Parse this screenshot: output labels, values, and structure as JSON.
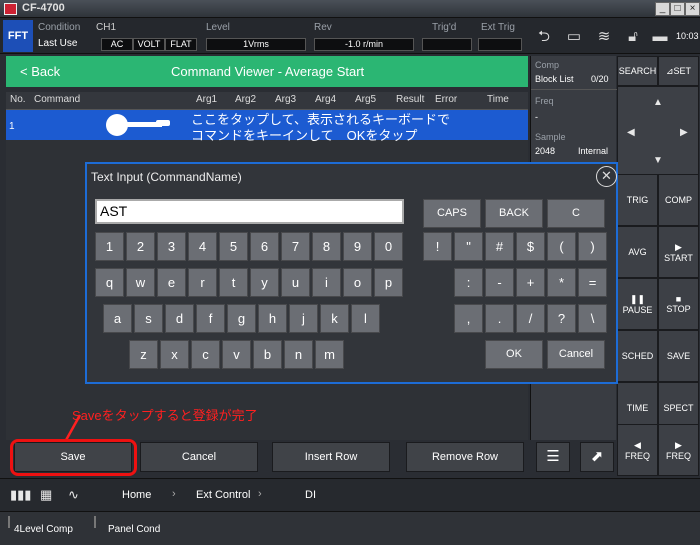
{
  "window": {
    "title": "CF-4700"
  },
  "status": {
    "mode": "FFT",
    "condition_label": "Condition",
    "condition_value": "Last Use",
    "channel_label": "CH1",
    "ch_settings": [
      "AC",
      "VOLT",
      "FLAT"
    ],
    "level_label": "Level",
    "level_value": "1Vrms",
    "rev_label": "Rev",
    "rev_value": "-1.0 r/min",
    "trig_label": "Trig'd",
    "exttrig_label": "Ext Trig",
    "clock": "10:03"
  },
  "header": {
    "back_label": "< Back",
    "title": "Command Viewer -  Average Start"
  },
  "table": {
    "columns": [
      "No.",
      "Command",
      "Arg1",
      "Arg2",
      "Arg3",
      "Arg4",
      "Arg5",
      "Result",
      "Error",
      "Time"
    ],
    "row1_no": "1",
    "row1_hint_line1": "ここをタップして、表示されるキーボードで",
    "row1_hint_line2": "コマンドをキーインして　OKをタップ"
  },
  "info_panel": {
    "comp_label": "Comp",
    "block_list_label": "Block List",
    "block_list_value": "0/20",
    "freq_label": "Freq",
    "freq_value": "-",
    "sample_label": "Sample",
    "sample_value": "2048",
    "sample_mode": "Internal"
  },
  "right_keys": {
    "search": "SEARCH",
    "set": "⊿SET",
    "trig": "TRIG",
    "comp": "COMP",
    "avg": "AVG",
    "start": "START",
    "pause": "PAUSE",
    "stop": "STOP",
    "sched": "SCHED",
    "save": "SAVE",
    "time": "TIME",
    "spect": "SPECT",
    "freq_left": "FREQ",
    "freq_right": "FREQ"
  },
  "dialog": {
    "title": "Text Input (CommandName)",
    "input_value": "AST",
    "row1": [
      "1",
      "2",
      "3",
      "4",
      "5",
      "6",
      "7",
      "8",
      "9",
      "0"
    ],
    "row2": [
      "q",
      "w",
      "e",
      "r",
      "t",
      "y",
      "u",
      "i",
      "o",
      "p"
    ],
    "row3": [
      "a",
      "s",
      "d",
      "f",
      "g",
      "h",
      "j",
      "k",
      "l"
    ],
    "row4": [
      "z",
      "x",
      "c",
      "v",
      "b",
      "n",
      "m"
    ],
    "caps": "CAPS",
    "backspace": "BACK",
    "clear": "C",
    "sym1": [
      "!",
      "\"",
      "#",
      "$",
      "(",
      ")"
    ],
    "sym2": [
      ":",
      "-",
      "+",
      "*",
      "="
    ],
    "sym3": [
      ",",
      ".",
      "/",
      "?",
      "\\"
    ],
    "ok": "OK",
    "cancel": "Cancel"
  },
  "annotation": {
    "text": "Saveをタップすると登録が完了",
    "color": "#ff2020"
  },
  "bottom_buttons": {
    "save": "Save",
    "cancel": "Cancel",
    "insert_row": "Insert Row",
    "remove_row": "Remove Row"
  },
  "breadcrumb": [
    "Home",
    "Ext Control",
    "DI"
  ],
  "footer_tabs": [
    "4Level Comp",
    "Panel Cond"
  ],
  "colors": {
    "accent_green": "#2bb673",
    "selection_blue": "#1c5bd1",
    "dialog_border": "#1d6cd6",
    "fft_blue": "#1d4fb7",
    "highlight_red": "#e11111"
  }
}
